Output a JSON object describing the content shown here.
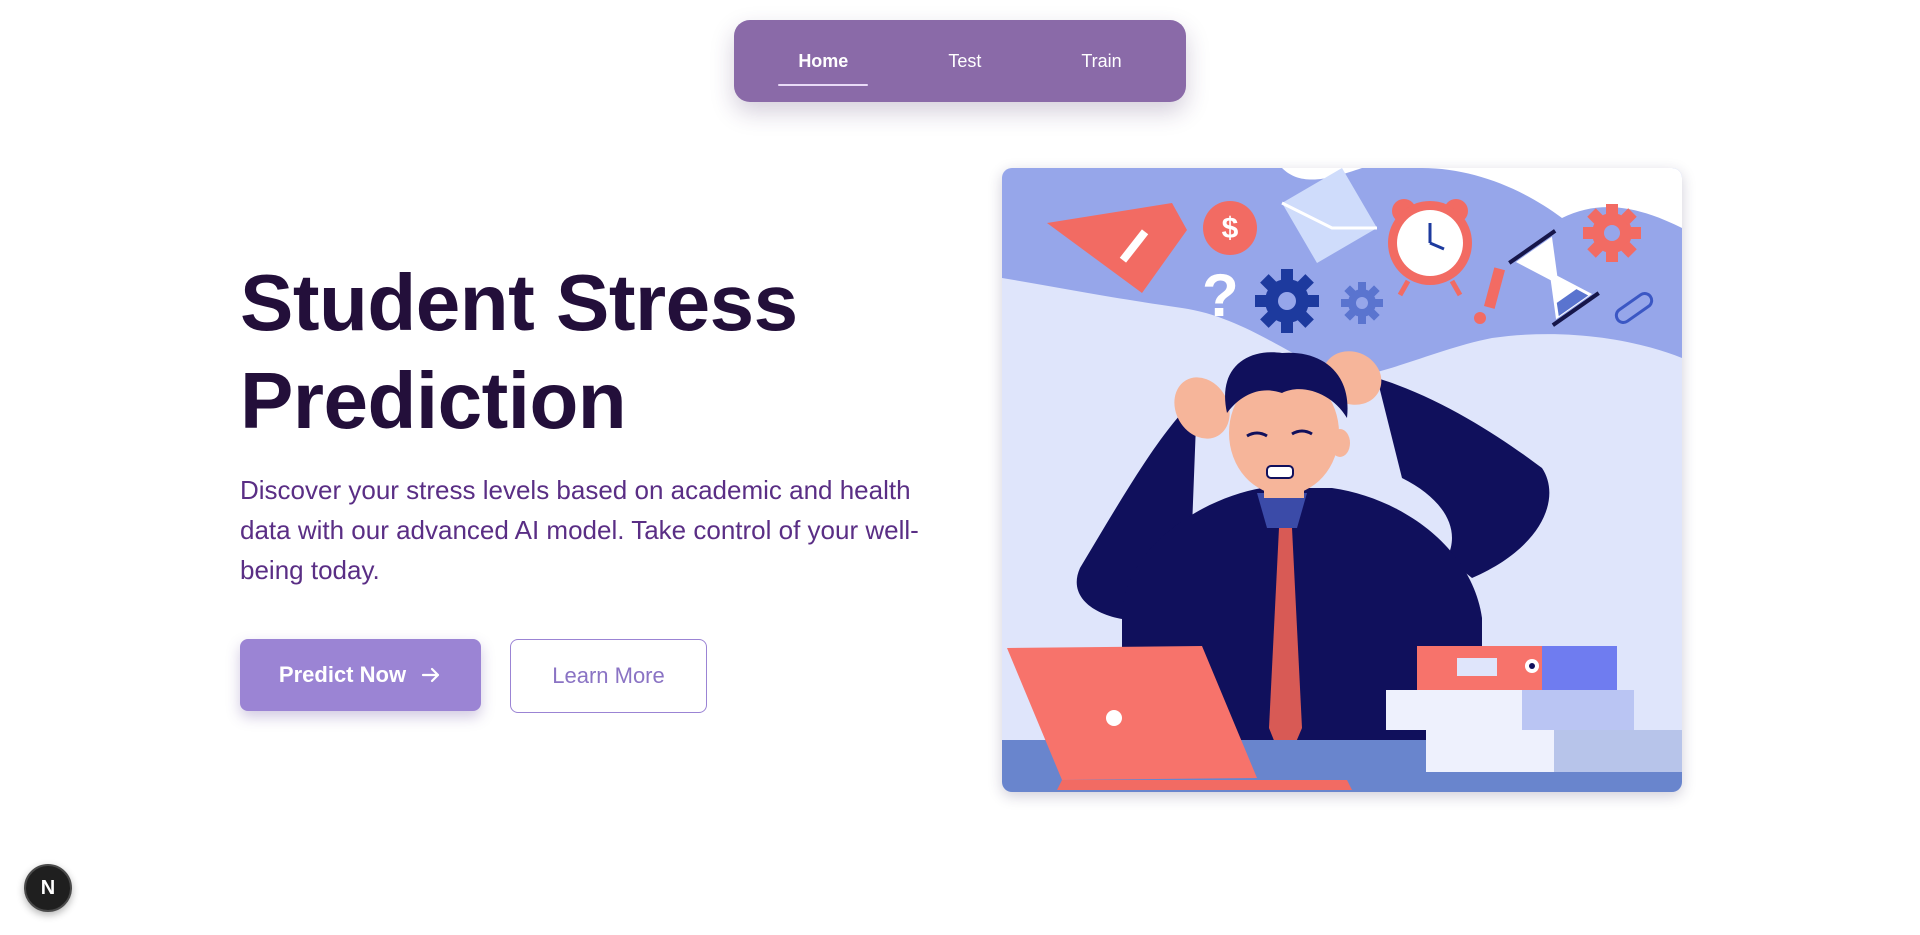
{
  "nav": {
    "items": [
      {
        "label": "Home",
        "active": true
      },
      {
        "label": "Test",
        "active": false
      },
      {
        "label": "Train",
        "active": false
      }
    ]
  },
  "hero": {
    "title_line1": "Student Stress",
    "title_line2": "Prediction",
    "description": "Discover your stress levels based on academic and health data with our advanced AI model. Take control of your well-being today.",
    "primary_button": "Predict Now",
    "secondary_button": "Learn More"
  },
  "dev_badge": {
    "letter": "N"
  },
  "colors": {
    "nav_bg": "#8a6aa8",
    "title": "#230f3a",
    "description": "#5a2e85",
    "primary_button": "#9b84d4"
  },
  "icons": {
    "primary_button": "arrow-right-icon",
    "illustration": "stressed-student-illustration"
  }
}
